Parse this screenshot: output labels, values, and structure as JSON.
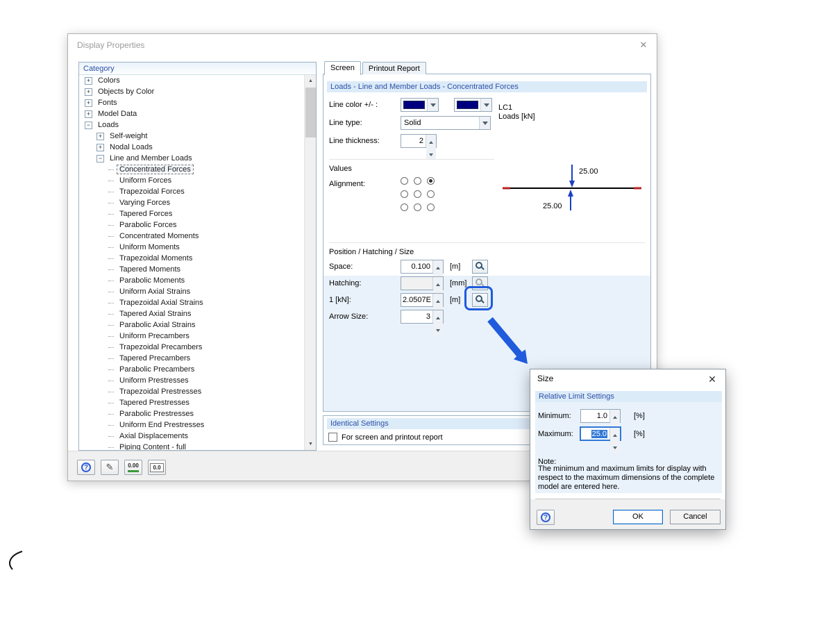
{
  "colors": {
    "accent_blue": "#2d50a7",
    "band_bg": "#dcebf8",
    "panel_blue": "#e9f2fb",
    "annotation_blue": "#1f5bdc",
    "swatch_navy": "#00007f",
    "selection_blue": "#2f78d6",
    "beam_black": "#000000",
    "beam_end_red": "#bb2222",
    "arrow_blue": "#1b3fc4"
  },
  "icons": {
    "close_glyph": "✕",
    "help_glyph": "?",
    "edit_glyph": "✎",
    "decimals_label": "0.00",
    "units_label": "0.0",
    "scroll_up": "▲",
    "scroll_down": "▼",
    "expand_glyph": "+",
    "collapse_glyph": "−"
  },
  "main_dialog": {
    "title": "Display Properties",
    "category": {
      "header": "Category",
      "items": [
        {
          "label": "Colors",
          "level": 0,
          "expand": "plus"
        },
        {
          "label": "Objects by Color",
          "level": 0,
          "expand": "plus"
        },
        {
          "label": "Fonts",
          "level": 0,
          "expand": "plus"
        },
        {
          "label": "Model Data",
          "level": 0,
          "expand": "plus"
        },
        {
          "label": "Loads",
          "level": 0,
          "expand": "minus"
        },
        {
          "label": "Self-weight",
          "level": 1,
          "expand": "plus"
        },
        {
          "label": "Nodal Loads",
          "level": 1,
          "expand": "plus"
        },
        {
          "label": "Line and Member Loads",
          "level": 1,
          "expand": "minus"
        },
        {
          "label": "Concentrated Forces",
          "level": 2,
          "selected": true
        },
        {
          "label": "Uniform Forces",
          "level": 2
        },
        {
          "label": "Trapezoidal Forces",
          "level": 2
        },
        {
          "label": "Varying Forces",
          "level": 2
        },
        {
          "label": "Tapered Forces",
          "level": 2
        },
        {
          "label": "Parabolic Forces",
          "level": 2
        },
        {
          "label": "Concentrated Moments",
          "level": 2
        },
        {
          "label": "Uniform Moments",
          "level": 2
        },
        {
          "label": "Trapezoidal Moments",
          "level": 2
        },
        {
          "label": "Tapered Moments",
          "level": 2
        },
        {
          "label": "Parabolic Moments",
          "level": 2
        },
        {
          "label": "Uniform Axial Strains",
          "level": 2
        },
        {
          "label": "Trapezoidal Axial Strains",
          "level": 2
        },
        {
          "label": "Tapered Axial Strains",
          "level": 2
        },
        {
          "label": "Parabolic Axial Strains",
          "level": 2
        },
        {
          "label": "Uniform Precambers",
          "level": 2
        },
        {
          "label": "Trapezoidal Precambers",
          "level": 2
        },
        {
          "label": "Tapered Precambers",
          "level": 2
        },
        {
          "label": "Parabolic Precambers",
          "level": 2
        },
        {
          "label": "Uniform Prestresses",
          "level": 2
        },
        {
          "label": "Trapezoidal Prestresses",
          "level": 2
        },
        {
          "label": "Tapered Prestresses",
          "level": 2
        },
        {
          "label": "Parabolic Prestresses",
          "level": 2
        },
        {
          "label": "Uniform End Prestresses",
          "level": 2
        },
        {
          "label": "Axial Displacements",
          "level": 2
        },
        {
          "label": "Piping Content - full",
          "level": 2
        }
      ]
    },
    "tabs": [
      {
        "label": "Screen",
        "active": true
      },
      {
        "label": "Printout Report",
        "active": false
      }
    ],
    "group_header": "Loads - Line and Member Loads - Concentrated Forces",
    "form": {
      "line_color_label": "Line color +/- :",
      "line_type_label": "Line type:",
      "line_type_value": "Solid",
      "line_thickness_label": "Line thickness:",
      "line_thickness_value": "2",
      "values_section_label": "Values",
      "alignment_label": "Alignment:",
      "alignment_selected": [
        0,
        2
      ],
      "position_section_label": "Position / Hatching / Size",
      "space_label": "Space:",
      "space_value": "0.100",
      "space_unit": "[m]",
      "hatching_label": "Hatching:",
      "hatching_value": "",
      "hatching_unit": "[mm]",
      "force_scale_label": "1 [kN]:",
      "force_scale_value": "2.0507E",
      "force_scale_unit": "[m]",
      "arrow_size_label": "Arrow Size:",
      "arrow_size_value": "3"
    },
    "preview": {
      "case_label": "LC1",
      "loads_label": "Loads [kN]",
      "top_arrow_value": "25.00",
      "bottom_arrow_value": "25.00"
    },
    "identical_settings": {
      "header": "Identical Settings",
      "checkbox_label": "For screen and printout report",
      "checked": false
    }
  },
  "size_dialog": {
    "title": "Size",
    "group_header": "Relative Limit Settings",
    "minimum_label": "Minimum:",
    "minimum_value": "1.0",
    "minimum_unit": "[%]",
    "maximum_label": "Maximum:",
    "maximum_value": "25.0",
    "maximum_unit": "[%]",
    "note_label": "Note:",
    "note_text": "The minimum and maximum limits for display with respect to the maximum dimensions of the complete model are entered here.",
    "ok_label": "OK",
    "cancel_label": "Cancel"
  }
}
